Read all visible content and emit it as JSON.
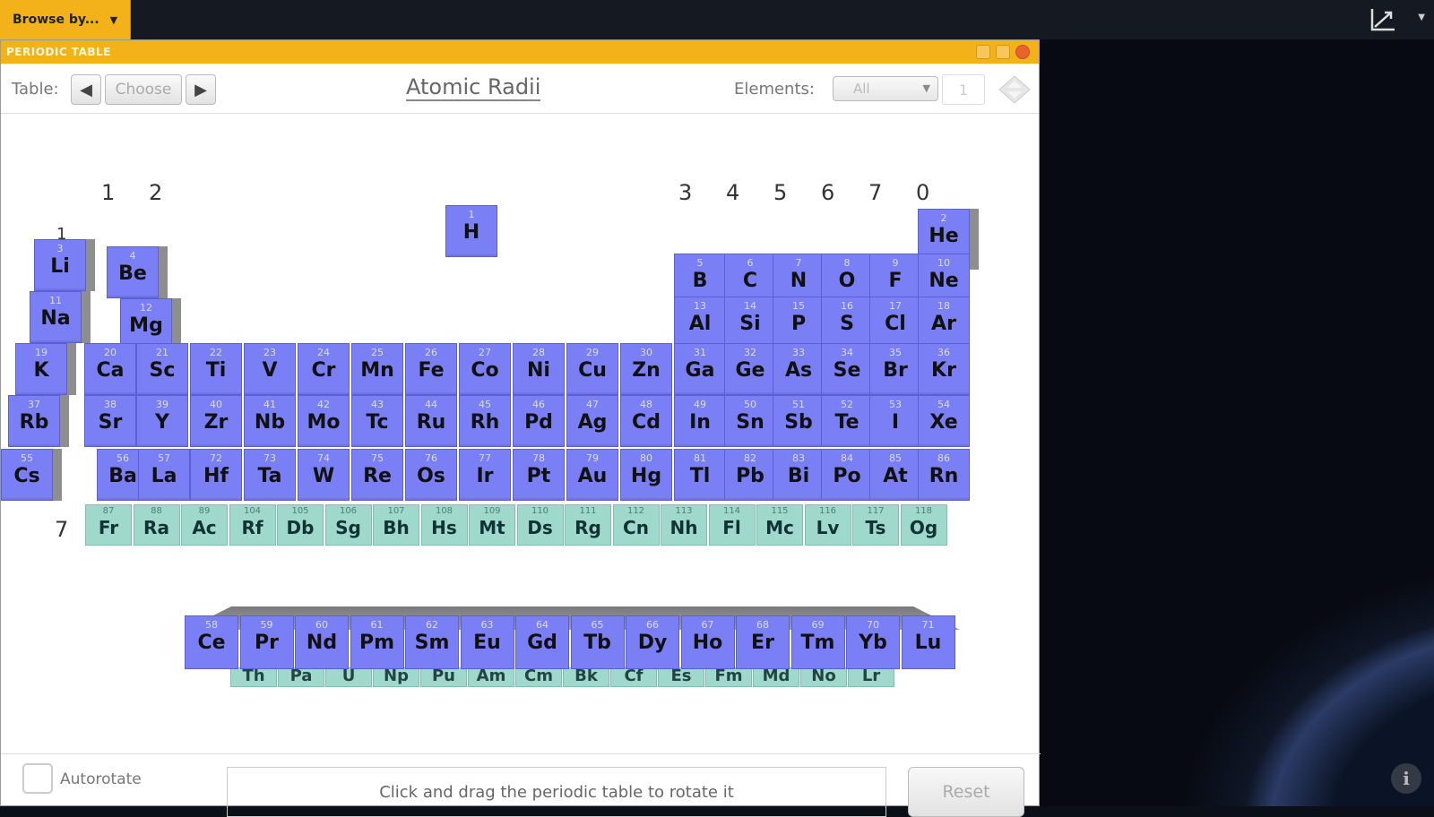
{
  "topbar": {
    "browse_label": "Browse by...",
    "graph_icon": "graph-icon"
  },
  "panel": {
    "title": "PERIODIC TABLE",
    "toolbar": {
      "table_label": "Table:",
      "choose_label": "Choose",
      "table_title": "Atomic Radii",
      "elements_label": "Elements:",
      "elements_value": "All",
      "count_value": "1"
    },
    "groups": [
      "1",
      "2",
      "3",
      "4",
      "5",
      "6",
      "7",
      "0"
    ],
    "period_labels": [
      "1",
      "7"
    ],
    "bottom": {
      "autorotate_label": "Autorotate",
      "hint": "Click and drag the periodic table to rotate it",
      "reset_label": "Reset"
    }
  },
  "colors": {
    "main_element": "#7b7ff6",
    "superheavy_element": "#9ed9cc",
    "accent": "#f4b21a"
  },
  "elements": [
    {
      "z": "1",
      "s": "H"
    },
    {
      "z": "2",
      "s": "He"
    },
    {
      "z": "3",
      "s": "Li"
    },
    {
      "z": "4",
      "s": "Be"
    },
    {
      "z": "5",
      "s": "B"
    },
    {
      "z": "6",
      "s": "C"
    },
    {
      "z": "7",
      "s": "N"
    },
    {
      "z": "8",
      "s": "O"
    },
    {
      "z": "9",
      "s": "F"
    },
    {
      "z": "10",
      "s": "Ne"
    },
    {
      "z": "11",
      "s": "Na"
    },
    {
      "z": "12",
      "s": "Mg"
    },
    {
      "z": "13",
      "s": "Al"
    },
    {
      "z": "14",
      "s": "Si"
    },
    {
      "z": "15",
      "s": "P"
    },
    {
      "z": "16",
      "s": "S"
    },
    {
      "z": "17",
      "s": "Cl"
    },
    {
      "z": "18",
      "s": "Ar"
    },
    {
      "z": "19",
      "s": "K"
    },
    {
      "z": "20",
      "s": "Ca"
    },
    {
      "z": "21",
      "s": "Sc"
    },
    {
      "z": "22",
      "s": "Ti"
    },
    {
      "z": "23",
      "s": "V"
    },
    {
      "z": "24",
      "s": "Cr"
    },
    {
      "z": "25",
      "s": "Mn"
    },
    {
      "z": "26",
      "s": "Fe"
    },
    {
      "z": "27",
      "s": "Co"
    },
    {
      "z": "28",
      "s": "Ni"
    },
    {
      "z": "29",
      "s": "Cu"
    },
    {
      "z": "30",
      "s": "Zn"
    },
    {
      "z": "31",
      "s": "Ga"
    },
    {
      "z": "32",
      "s": "Ge"
    },
    {
      "z": "33",
      "s": "As"
    },
    {
      "z": "34",
      "s": "Se"
    },
    {
      "z": "35",
      "s": "Br"
    },
    {
      "z": "36",
      "s": "Kr"
    },
    {
      "z": "37",
      "s": "Rb"
    },
    {
      "z": "38",
      "s": "Sr"
    },
    {
      "z": "39",
      "s": "Y"
    },
    {
      "z": "40",
      "s": "Zr"
    },
    {
      "z": "41",
      "s": "Nb"
    },
    {
      "z": "42",
      "s": "Mo"
    },
    {
      "z": "43",
      "s": "Tc"
    },
    {
      "z": "44",
      "s": "Ru"
    },
    {
      "z": "45",
      "s": "Rh"
    },
    {
      "z": "46",
      "s": "Pd"
    },
    {
      "z": "47",
      "s": "Ag"
    },
    {
      "z": "48",
      "s": "Cd"
    },
    {
      "z": "49",
      "s": "In"
    },
    {
      "z": "50",
      "s": "Sn"
    },
    {
      "z": "51",
      "s": "Sb"
    },
    {
      "z": "52",
      "s": "Te"
    },
    {
      "z": "53",
      "s": "I"
    },
    {
      "z": "54",
      "s": "Xe"
    },
    {
      "z": "55",
      "s": "Cs"
    },
    {
      "z": "56",
      "s": "Ba"
    },
    {
      "z": "57",
      "s": "La"
    },
    {
      "z": "72",
      "s": "Hf"
    },
    {
      "z": "73",
      "s": "Ta"
    },
    {
      "z": "74",
      "s": "W"
    },
    {
      "z": "75",
      "s": "Re"
    },
    {
      "z": "76",
      "s": "Os"
    },
    {
      "z": "77",
      "s": "Ir"
    },
    {
      "z": "78",
      "s": "Pt"
    },
    {
      "z": "79",
      "s": "Au"
    },
    {
      "z": "80",
      "s": "Hg"
    },
    {
      "z": "81",
      "s": "Tl"
    },
    {
      "z": "82",
      "s": "Pb"
    },
    {
      "z": "83",
      "s": "Bi"
    },
    {
      "z": "84",
      "s": "Po"
    },
    {
      "z": "85",
      "s": "At"
    },
    {
      "z": "86",
      "s": "Rn"
    }
  ],
  "period7": [
    {
      "z": "87",
      "s": "Fr"
    },
    {
      "z": "88",
      "s": "Ra"
    },
    {
      "z": "89",
      "s": "Ac"
    },
    {
      "z": "104",
      "s": "Rf"
    },
    {
      "z": "105",
      "s": "Db"
    },
    {
      "z": "106",
      "s": "Sg"
    },
    {
      "z": "107",
      "s": "Bh"
    },
    {
      "z": "108",
      "s": "Hs"
    },
    {
      "z": "109",
      "s": "Mt"
    },
    {
      "z": "110",
      "s": "Ds"
    },
    {
      "z": "111",
      "s": "Rg"
    },
    {
      "z": "112",
      "s": "Cn"
    },
    {
      "z": "113",
      "s": "Nh"
    },
    {
      "z": "114",
      "s": "Fl"
    },
    {
      "z": "115",
      "s": "Mc"
    },
    {
      "z": "116",
      "s": "Lv"
    },
    {
      "z": "117",
      "s": "Ts"
    },
    {
      "z": "118",
      "s": "Og"
    }
  ],
  "lanthanides": [
    {
      "z": "58",
      "s": "Ce"
    },
    {
      "z": "59",
      "s": "Pr"
    },
    {
      "z": "60",
      "s": "Nd"
    },
    {
      "z": "61",
      "s": "Pm"
    },
    {
      "z": "62",
      "s": "Sm"
    },
    {
      "z": "63",
      "s": "Eu"
    },
    {
      "z": "64",
      "s": "Gd"
    },
    {
      "z": "65",
      "s": "Tb"
    },
    {
      "z": "66",
      "s": "Dy"
    },
    {
      "z": "67",
      "s": "Ho"
    },
    {
      "z": "68",
      "s": "Er"
    },
    {
      "z": "69",
      "s": "Tm"
    },
    {
      "z": "70",
      "s": "Yb"
    },
    {
      "z": "71",
      "s": "Lu"
    }
  ],
  "actinides": [
    "Th",
    "Pa",
    "U",
    "Np",
    "Pu",
    "Am",
    "Cm",
    "Bk",
    "Cf",
    "Es",
    "Fm",
    "Md",
    "No",
    "Lr"
  ]
}
